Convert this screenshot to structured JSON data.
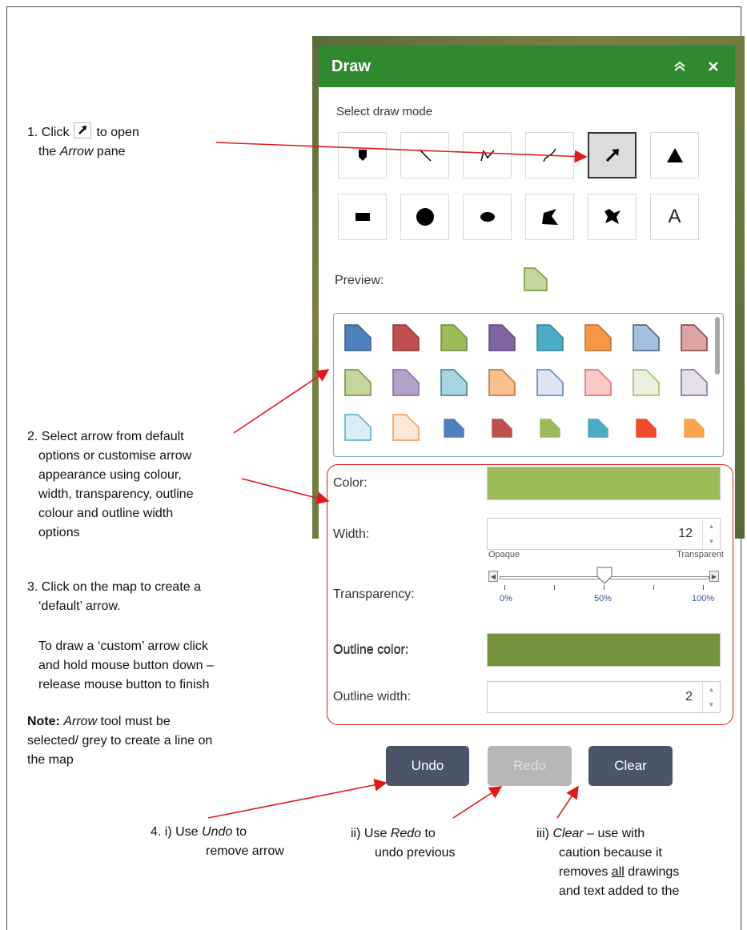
{
  "panel": {
    "title": "Draw",
    "collapse_icon": "double-chevron-up-icon",
    "close_icon": "close-icon",
    "select_mode_label": "Select draw mode",
    "modes": [
      {
        "name": "point",
        "icon": "point-pin-icon",
        "selected": false
      },
      {
        "name": "line",
        "icon": "line-icon",
        "selected": false
      },
      {
        "name": "polyline",
        "icon": "polyline-icon",
        "selected": false
      },
      {
        "name": "freehand-line",
        "icon": "freehand-line-icon",
        "selected": false
      },
      {
        "name": "arrow",
        "icon": "arrow-icon",
        "selected": true
      },
      {
        "name": "triangle",
        "icon": "triangle-icon",
        "selected": false
      },
      {
        "name": "rectangle",
        "icon": "rectangle-icon",
        "selected": false
      },
      {
        "name": "circle",
        "icon": "circle-icon",
        "selected": false
      },
      {
        "name": "ellipse",
        "icon": "ellipse-icon",
        "selected": false
      },
      {
        "name": "polygon",
        "icon": "polygon-icon",
        "selected": false
      },
      {
        "name": "freehand-polygon",
        "icon": "freehand-polygon-icon",
        "selected": false
      },
      {
        "name": "text",
        "icon": "text-icon",
        "label": "A",
        "selected": false
      }
    ],
    "preview_label": "Preview:",
    "preview_color": "#c3d69b",
    "preview_outline": "#76923c",
    "symbols": [
      {
        "fill": "#4f81bd",
        "stroke": "#385d8a"
      },
      {
        "fill": "#c0504d",
        "stroke": "#8c3836"
      },
      {
        "fill": "#9bbb59",
        "stroke": "#71893f"
      },
      {
        "fill": "#8064a2",
        "stroke": "#5c4776"
      },
      {
        "fill": "#4bacc6",
        "stroke": "#357d91"
      },
      {
        "fill": "#f79646",
        "stroke": "#b66d31"
      },
      {
        "fill": "#a7bfde",
        "stroke": "#385d8a"
      },
      {
        "fill": "#dba5a4",
        "stroke": "#8c3836"
      },
      {
        "fill": "#c3d69b",
        "stroke": "#71893f"
      },
      {
        "fill": "#b3a2c7",
        "stroke": "#8064a2"
      },
      {
        "fill": "#a5d5e2",
        "stroke": "#357d91"
      },
      {
        "fill": "#fac090",
        "stroke": "#b66d31"
      },
      {
        "fill": "#dce6f2",
        "stroke": "#4f81bd"
      },
      {
        "fill": "#f9c9c8",
        "stroke": "#e06666"
      },
      {
        "fill": "#ebf1de",
        "stroke": "#9bbb59"
      },
      {
        "fill": "#e6e0ec",
        "stroke": "#8064a2"
      },
      {
        "fill": "#daeef3",
        "stroke": "#4bacc6"
      },
      {
        "fill": "#fde9d9",
        "stroke": "#f79646"
      },
      {
        "fill": "#4f81bd",
        "stroke": "#4f81bd"
      },
      {
        "fill": "#c0504d",
        "stroke": "#c0504d"
      },
      {
        "fill": "#9bbb59",
        "stroke": "#9bbb59"
      },
      {
        "fill": "#4bacc6",
        "stroke": "#4bacc6"
      },
      {
        "fill": "#f04b2a",
        "stroke": "#f04b2a"
      },
      {
        "fill": "#f9a34c",
        "stroke": "#f9a34c"
      }
    ],
    "color_label": "Color:",
    "color_value": "#9bbb59",
    "width_label": "Width:",
    "width_value": "12",
    "transparency_label": "Transparency:",
    "slider_left_caption": "Opaque",
    "slider_right_caption": "Transparent",
    "tick_0": "0%",
    "tick_50": "50%",
    "tick_100": "100%",
    "transparency_value": 0.5,
    "outline_color_label": "Outline color:",
    "outline_color_value": "#76923c",
    "outline_width_label": "Outline width:",
    "outline_width_value": "2",
    "undo_label": "Undo",
    "redo_label": "Redo",
    "clear_label": "Clear"
  },
  "annotations": {
    "step1_a": "1. Click",
    "step1_b": "to open",
    "step1_c": "the ",
    "step1_arrow": "Arrow",
    "step1_d": " pane",
    "step2": [
      "2. Select arrow from default",
      "options or customise arrow",
      "appearance using colour,",
      "width, transparency, outline",
      "colour and outline width",
      "options"
    ],
    "step3": [
      "3. Click on the map to create a",
      "‘default’ arrow."
    ],
    "step3_custom": [
      "To draw a ‘custom’ arrow click",
      "and hold mouse button down –",
      "release mouse button to finish"
    ],
    "note_bold": "Note:",
    "note_arrow": "Arrow",
    "note_rest_1": " tool must be",
    "note_rest_2": "selected/ grey to create a line on",
    "note_rest_3": "the map",
    "step4_prefix": "4.  i)  Use ",
    "step4_undo": "Undo",
    "step4_suffix_1": " to",
    "step4_line2": "remove arrow",
    "step4ii_prefix": "ii)  Use ",
    "step4ii_redo": "Redo",
    "step4ii_suffix": " to",
    "step4ii_line2": "undo previous",
    "step4iii_prefix": "iii) ",
    "step4iii_clear": "Clear",
    "step4iii_rest": " – use with",
    "step4iii_line2": "caution because it",
    "step4iii_line3a": "removes ",
    "step4iii_all": "all",
    "step4iii_line3b": " drawings",
    "step4iii_line4": "and text added to the"
  }
}
